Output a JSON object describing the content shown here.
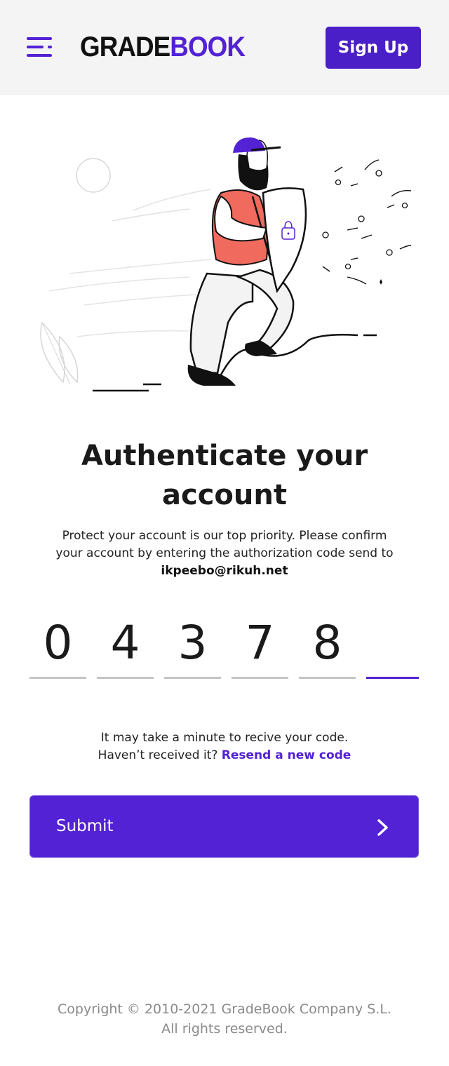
{
  "header": {
    "logo_part1": "GRADE",
    "logo_part2": "BOOK",
    "signup_label": "Sign Up"
  },
  "main": {
    "title": "Authenticate your account",
    "description": "Protect your account is our top priority. Please confirm your account by entering the authorization code send to",
    "email": "ikpeebo@rikuh.net",
    "code_digits": [
      "0",
      "4",
      "3",
      "7",
      "8",
      ""
    ],
    "hint_line1": "It may take a minute to  recive your code.",
    "hint_line2": "Haven’t received it?",
    "resend_label": "Resend a new code",
    "submit_label": "Submit"
  },
  "footer": {
    "copyright": "Copyright © 2010-2021 GradeBook Company S.L. All rights reserved."
  },
  "colors": {
    "accent": "#5322d4",
    "header_bg": "#f4f4f4",
    "footer_text": "#8a8a8a"
  },
  "icons": {
    "menu": "menu-icon",
    "submit_arrow": "chevron-right-icon",
    "illustration": "security-shield-illustration"
  }
}
